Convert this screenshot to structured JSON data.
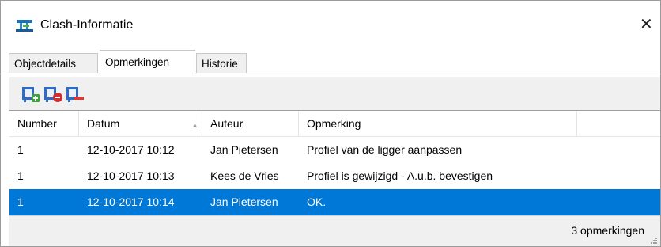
{
  "window": {
    "title": "Clash-Informatie",
    "icon": "clash-info-icon",
    "close_glyph": "✕"
  },
  "tabs": [
    {
      "label": "Objectdetails",
      "active": false
    },
    {
      "label": "Opmerkingen",
      "active": true
    },
    {
      "label": "Historie",
      "active": false
    }
  ],
  "toolbar": {
    "buttons": [
      {
        "icon": "add-comment-icon"
      },
      {
        "icon": "edit-comment-icon"
      },
      {
        "icon": "delete-comment-icon"
      }
    ]
  },
  "table": {
    "columns": [
      "Number",
      "Datum",
      "Auteur",
      "Opmerking"
    ],
    "sort": {
      "column": "Datum",
      "direction": "ascending"
    },
    "rows": [
      {
        "number": "1",
        "datum": "12-10-2017 10:12",
        "auteur": "Jan Pietersen",
        "opmerking": "Profiel van de ligger aanpassen",
        "selected": false
      },
      {
        "number": "1",
        "datum": "12-10-2017 10:13",
        "auteur": "Kees de Vries",
        "opmerking": "Profiel is gewijzigd - A.u.b. bevestigen",
        "selected": false
      },
      {
        "number": "1",
        "datum": "12-10-2017 10:14",
        "auteur": "Jan Pietersen",
        "opmerking": "OK.",
        "selected": true
      }
    ]
  },
  "status": {
    "text": "3 opmerkingen"
  },
  "colors": {
    "selection": "#0078d7",
    "toolbar_bg": "#f0f0f0"
  }
}
